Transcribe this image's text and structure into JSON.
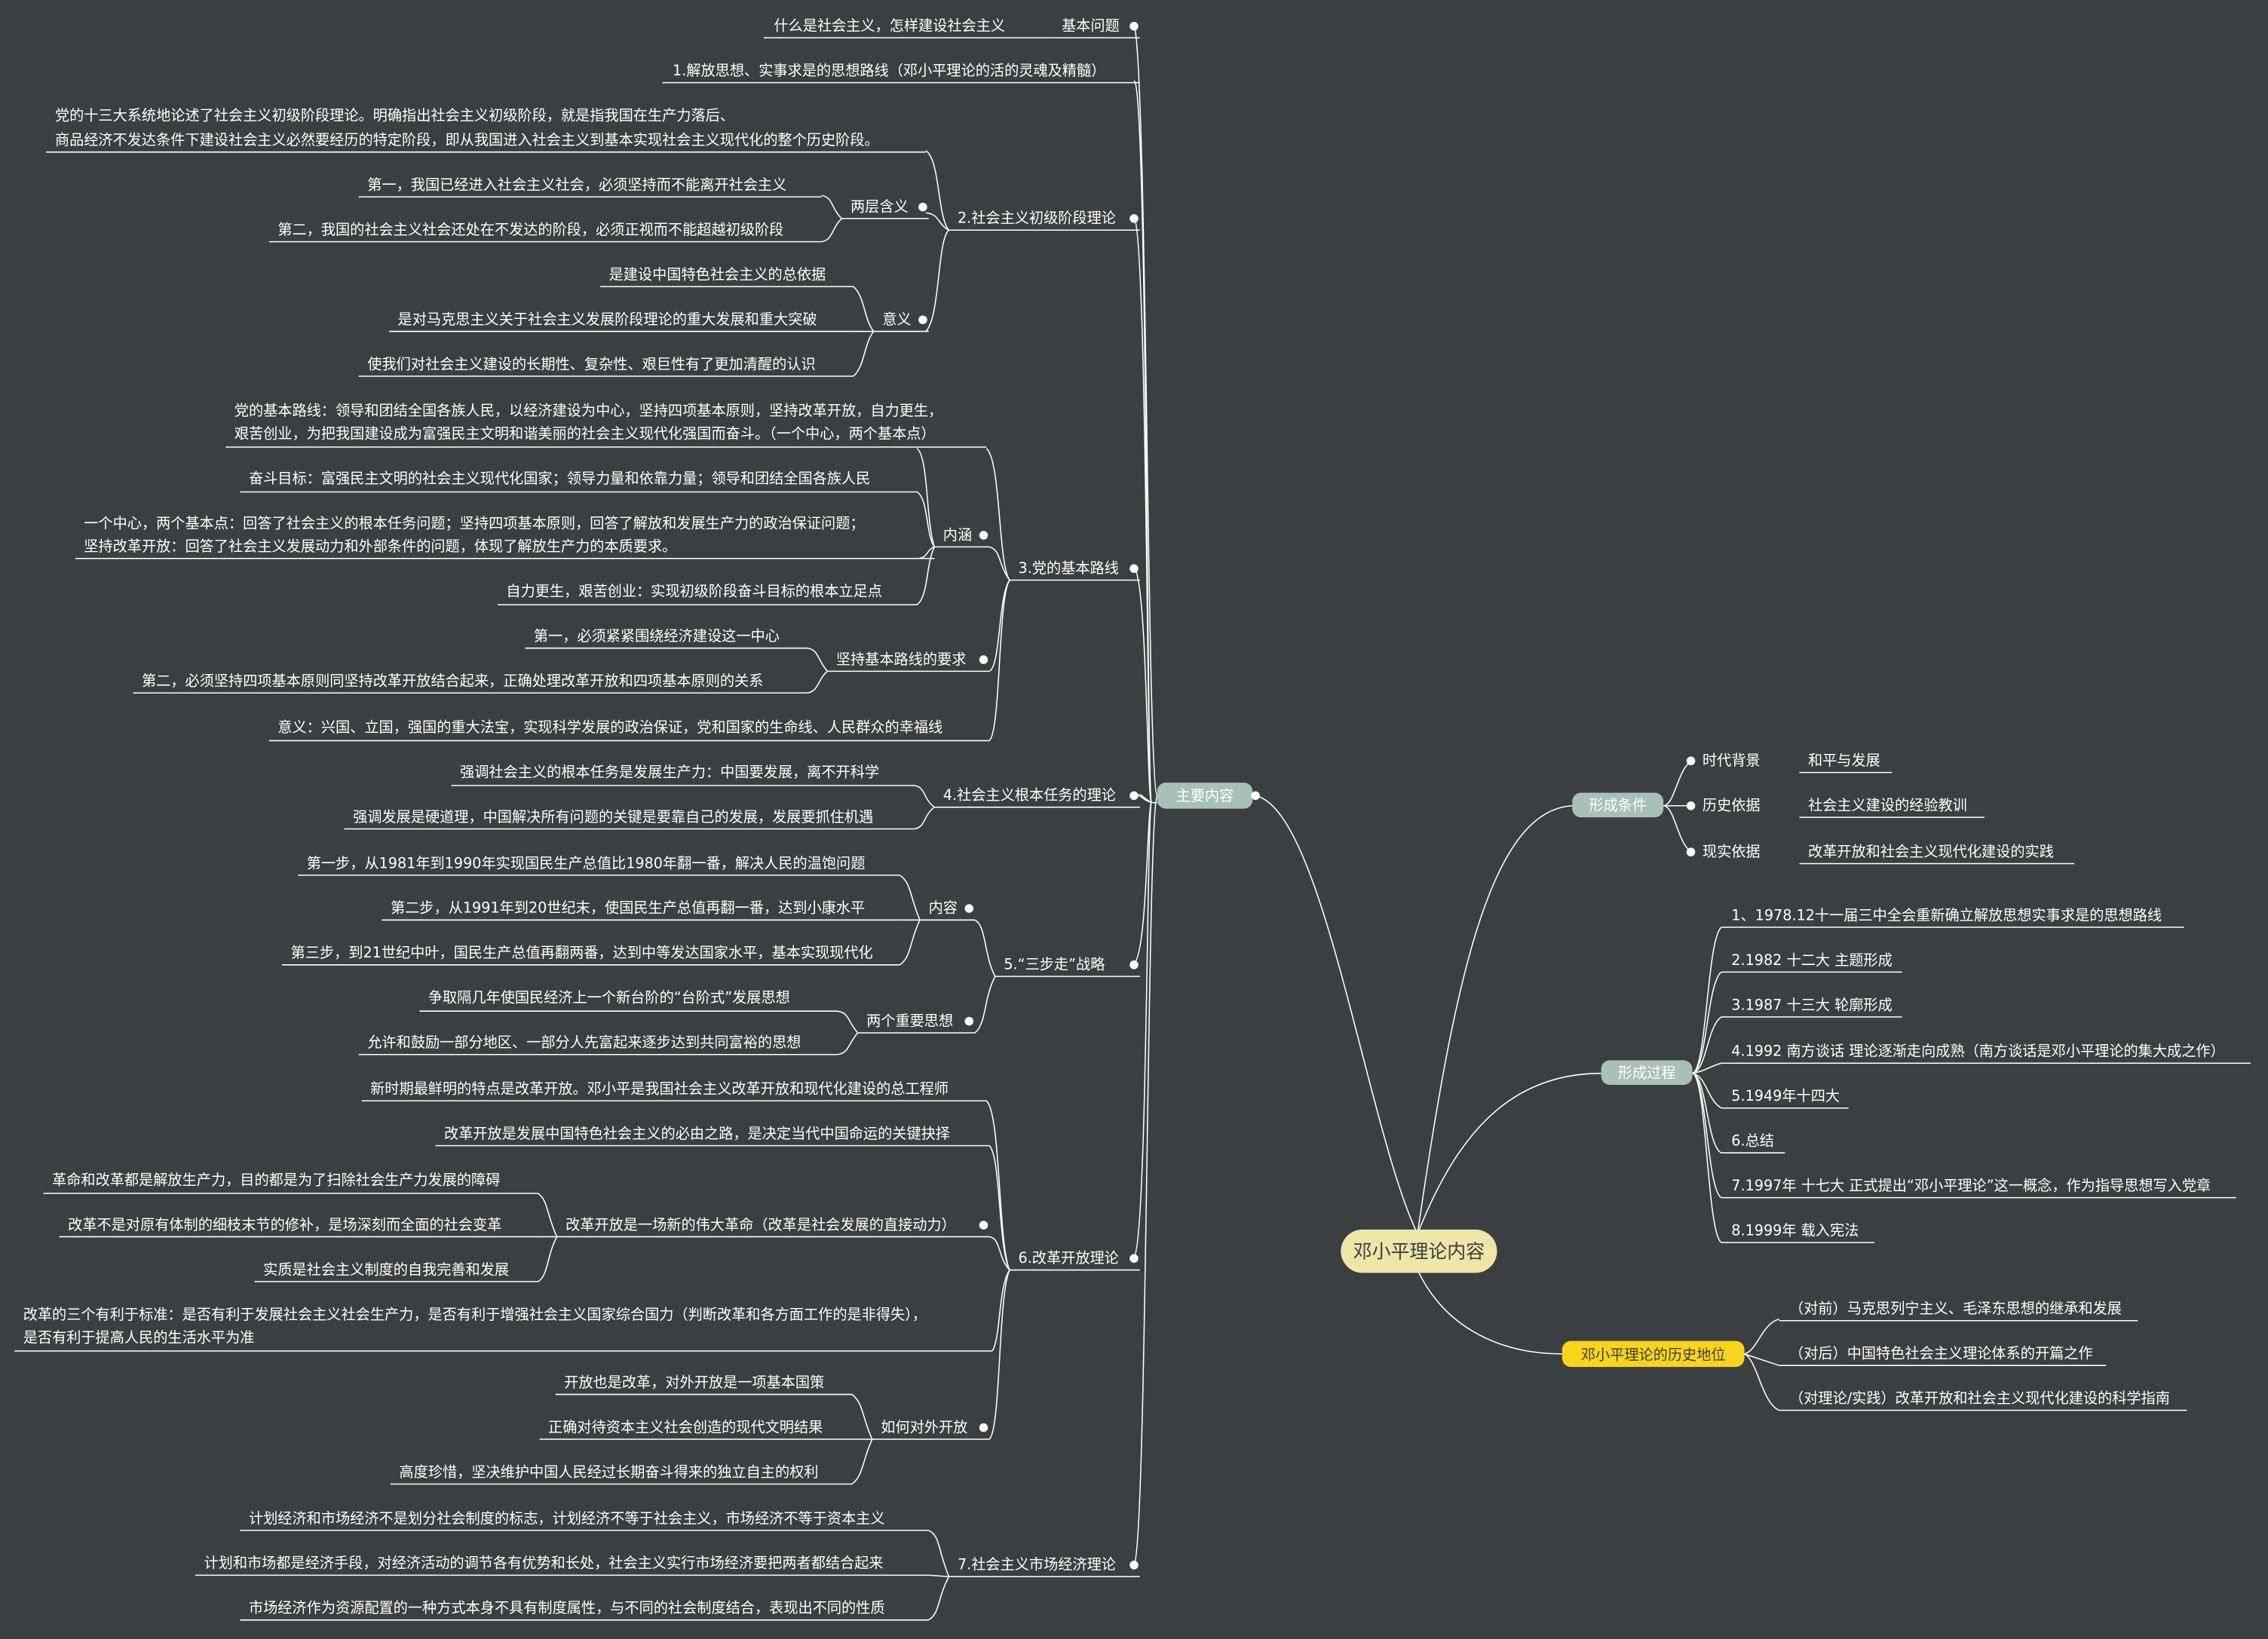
{
  "center": {
    "label": "邓小平理论内容"
  },
  "main_content": {
    "label": "主要内容",
    "basic_question": {
      "label": "基本问题",
      "text": "什么是社会主义，怎样建设社会主义"
    },
    "b1": {
      "label": "1.解放思想、实事求是的思想路线（邓小平理论的活的灵魂及精髓）"
    },
    "b2": {
      "label": "2.社会主义初级阶段理论",
      "intro_1": "党的十三大系统地论述了社会主义初级阶段理论。明确指出社会主义初级阶段，就是指我国在生产力落后、",
      "intro_2": "商品经济不发达条件下建设社会主义必然要经历的特定阶段，即从我国进入社会主义到基本实现社会主义现代化的整个历史阶段。",
      "two_meanings": {
        "label": "两层含义",
        "items": [
          "第一，我国已经进入社会主义社会，必须坚持而不能离开社会主义",
          "第二，我国的社会主义社会还处在不发达的阶段，必须正视而不能超越初级阶段"
        ]
      },
      "significance": {
        "label": "意义",
        "items": [
          "是建设中国特色社会主义的总依据",
          "是对马克思主义关于社会主义发展阶段理论的重大发展和重大突破",
          "使我们对社会主义建设的长期性、复杂性、艰巨性有了更加清醒的认识"
        ]
      }
    },
    "b3": {
      "label": "3.党的基本路线",
      "content": {
        "label": "内涵",
        "line_1": "党的基本路线：领导和团结全国各族人民，以经济建设为中心，坚持四项基本原则，坚持改革开放，自力更生，",
        "line_2": "艰苦创业，为把我国建设成为富强民主文明和谐美丽的社会主义现代化强国而奋斗。（一个中心，两个基本点）",
        "goal": "奋斗目标：富强民主文明的社会主义现代化国家；领导力量和依靠力量；领导和团结全国各族人民",
        "center_1": "一个中心，两个基本点：回答了社会主义的根本任务问题；坚持四项基本原则，回答了解放和发展生产力的政治保证问题；",
        "center_2": "坚持改革开放：回答了社会主义发展动力和外部条件的问题，体现了解放生产力的本质要求。",
        "self": "自力更生，艰苦创业：实现初级阶段奋斗目标的根本立足点"
      },
      "requirements": {
        "label": "坚持基本路线的要求",
        "items": [
          "第一，必须紧紧围绕经济建设这一中心",
          "第二，必须坚持四项基本原则同坚持改革开放结合起来，正确处理改革开放和四项基本原则的关系"
        ]
      },
      "significance": "意义：兴国、立国，强国的重大法宝，实现科学发展的政治保证，党和国家的生命线、人民群众的幸福线"
    },
    "b4": {
      "label": "4.社会主义根本任务的理论",
      "items": [
        "强调社会主义的根本任务是发展生产力：中国要发展，离不开科学",
        "强调发展是硬道理，中国解决所有问题的关键是要靠自己的发展，发展要抓住机遇"
      ]
    },
    "b5": {
      "label": "5.“三步走”战略",
      "content": {
        "label": "内容",
        "items": [
          "第一步，从1981年到1990年实现国民生产总值比1980年翻一番，解决人民的温饱问题",
          "第二步，从1991年到20世纪末，使国民生产总值再翻一番，达到小康水平",
          "第三步，到21世纪中叶，国民生产总值再翻两番，达到中等发达国家水平，基本实现现代化"
        ]
      },
      "ideas": {
        "label": "两个重要思想",
        "items": [
          "争取隔几年使国民经济上一个新台阶的“台阶式”发展思想",
          "允许和鼓励一部分地区、一部分人先富起来逐步达到共同富裕的思想"
        ]
      }
    },
    "b6": {
      "label": "6.改革开放理论",
      "item_1": "新时期最鲜明的特点是改革开放。邓小平是我国社会主义改革开放和现代化建设的总工程师",
      "item_2": "改革开放是发展中国特色社会主义的必由之路，是决定当代中国命运的关键抉择",
      "revolution": {
        "label": "改革开放是一场新的伟大革命（改革是社会发展的直接动力）",
        "items": [
          "革命和改革都是解放生产力，目的都是为了扫除社会生产力发展的障碍",
          "改革不是对原有体制的细枝末节的修补，是场深刻而全面的社会变革",
          "实质是社会主义制度的自我完善和发展"
        ]
      },
      "criteria_1": "改革的三个有利于标准：是否有利于发展社会主义社会生产力，是否有利于增强社会主义国家综合国力（判断改革和各方面工作的是非得失），",
      "criteria_2": "是否有利于提高人民的生活水平为准",
      "opening": {
        "label": "如何对外开放",
        "items": [
          "开放也是改革，对外开放是一项基本国策",
          "正确对待资本主义社会创造的现代文明结果",
          "高度珍惜，坚决维护中国人民经过长期奋斗得来的独立自主的权利"
        ]
      }
    },
    "b7": {
      "label": "7.社会主义市场经济理论",
      "items": [
        "计划经济和市场经济不是划分社会制度的标志，计划经济不等于社会主义，市场经济不等于资本主义",
        "计划和市场都是经济手段，对经济活动的调节各有优势和长处，社会主义实行市场经济要把两者都结合起来",
        "市场经济作为资源配置的一种方式本身不具有制度属性，与不同的社会制度结合，表现出不同的性质"
      ]
    }
  },
  "conditions": {
    "label": "形成条件",
    "items": [
      {
        "label": "时代背景",
        "value": "和平与发展"
      },
      {
        "label": "历史依据",
        "value": "社会主义建设的经验教训"
      },
      {
        "label": "现实依据",
        "value": "改革开放和社会主义现代化建设的实践"
      }
    ]
  },
  "process": {
    "label": "形成过程",
    "items": [
      "1、1978.12十一届三中全会重新确立解放思想实事求是的思想路线",
      "2.1982 十二大 主题形成",
      "3.1987 十三大 轮廓形成",
      "4.1992 南方谈话 理论逐渐走向成熟（南方谈话是邓小平理论的集大成之作）",
      "5.1949年十四大",
      "6.总结",
      "7.1997年 十七大  正式提出“邓小平理论”这一概念，作为指导思想写入党章",
      "8.1999年 载入宪法"
    ]
  },
  "status": {
    "label": "邓小平理论的历史地位",
    "items": [
      "（对前）马克思列宁主义、毛泽东思想的继承和发展",
      "（对后）中国特色社会主义理论体系的开篇之作",
      "（对理论/实践）改革开放和社会主义现代化建设的科学指南"
    ]
  },
  "colors": {
    "background": "#3b3f41",
    "center_fill": "#ede6a6",
    "topic_fill": "#a9c0ba",
    "status_fill": "#f8d51c",
    "line": "#ffffff"
  }
}
